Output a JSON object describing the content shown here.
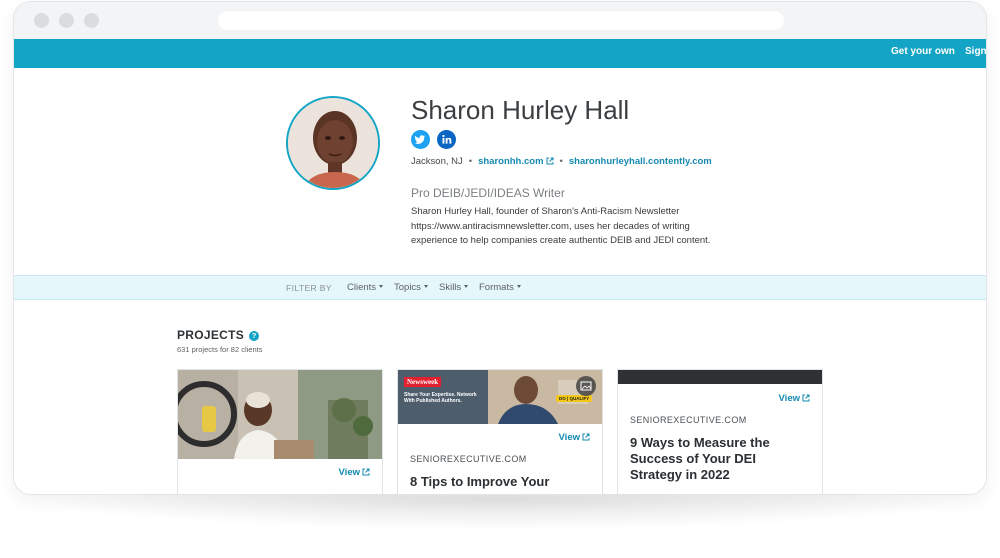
{
  "nav": {
    "get_your_own": "Get your own",
    "sign": "Sign"
  },
  "profile": {
    "name": "Sharon Hurley Hall",
    "location": "Jackson, NJ",
    "website": "sharonhh.com",
    "portfolio": "sharonhurleyhall.contently.com",
    "tagline": "Pro DEIB/JEDI/IDEAS Writer",
    "bio": "Sharon Hurley Hall, founder of Sharon's Anti-Racism Newsletter https://www.antiracismnewsletter.com, uses her decades of writing experience to help companies create authentic DEIB and JEDI content.",
    "social": [
      {
        "icon": "twitter-icon",
        "color": "#1da1f2"
      },
      {
        "icon": "linkedin-icon",
        "color": "#0a66c2"
      }
    ]
  },
  "filter": {
    "label": "FILTER BY",
    "options": [
      "Clients",
      "Topics",
      "Skills",
      "Formats"
    ]
  },
  "projects": {
    "title": "PROJECTS",
    "subtitle": "631 projects for 82 clients",
    "cards": [
      {
        "view": "View"
      },
      {
        "view": "View",
        "source": "SENIOREXECUTIVE.COM",
        "title": "8 Tips to Improve Your",
        "thumb": {
          "brand": "Newsweek",
          "headline": "Share Your Expertise. Network With Published Authors.",
          "badge": "DO | QUALIFY"
        }
      },
      {
        "view": "View",
        "source": "SENIOREXECUTIVE.COM",
        "title": "9 Ways to Measure the Success of Your DEI Strategy in 2022"
      }
    ]
  },
  "colors": {
    "accent": "#14a5c6",
    "link": "#148ab0",
    "filter_bg": "#e6f7fb"
  }
}
